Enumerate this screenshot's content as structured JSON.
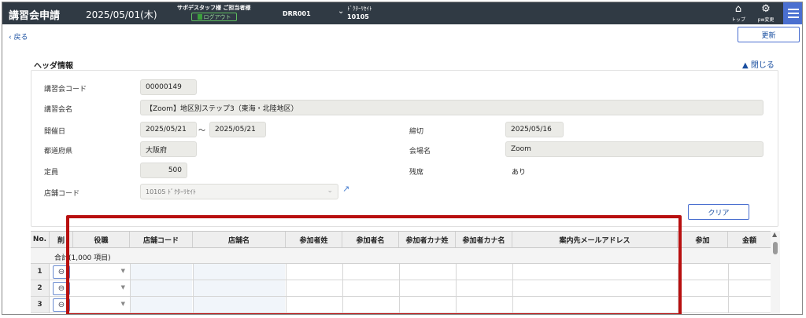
{
  "header": {
    "app_title": "講習会申請",
    "date": "2025/05/01(木)",
    "staff_line": "サポデスタッフ様 ご担当者様",
    "logout_label": "ログアウト",
    "code": "DRR001",
    "store_name": "ﾄﾞｸﾀｰﾘｾｲﾄ",
    "store_code": "10105",
    "top_label": "トップ",
    "pw_label": "pw変更"
  },
  "nav": {
    "back_label": "戻る",
    "update_label": "更新"
  },
  "section": {
    "title": "ヘッダ情報",
    "close_label": "閉じる"
  },
  "form": {
    "course_code_label": "講習会コード",
    "course_code_value": "00000149",
    "course_name_label": "講習会名",
    "course_name_value": "【Zoom】地区別ステップ3（東海・北陸地区）",
    "date_label": "開催日",
    "date_from": "2025/05/21",
    "date_sep": "～",
    "date_to": "2025/05/21",
    "deadline_label": "締切",
    "deadline_value": "2025/05/16",
    "prefecture_label": "都道府県",
    "prefecture_value": "大阪府",
    "venue_label": "会場名",
    "venue_value": "Zoom",
    "capacity_label": "定員",
    "capacity_value": "500",
    "remaining_label": "残席",
    "remaining_value": "あり",
    "store_code_label": "店舗コード",
    "store_code_value": "10105 ﾄﾞｸﾀｰﾘｾｲﾄ",
    "clear_label": "クリア"
  },
  "grid": {
    "columns": [
      "No.",
      "削",
      "役職",
      "店舗コード",
      "店舗名",
      "参加者姓",
      "参加者名",
      "参加者カナ姓",
      "参加者カナ名",
      "案内先メールアドレス",
      "参加",
      "金額"
    ],
    "total_label": "合計(1,000 項目)",
    "rows": [
      "1",
      "2",
      "3"
    ],
    "delete_glyph": "⊖",
    "dropdown_glyph": "▼"
  },
  "icons": {
    "back": "chevron-left-icon",
    "close": "chevron-up-icon",
    "home": "home-icon",
    "settings": "user-gear-icon",
    "menu": "hamburger-icon",
    "external": "external-link-icon"
  },
  "colors": {
    "topbar": "#303a44",
    "accent": "#4a6fd0",
    "highlight": "#b80f0f"
  }
}
